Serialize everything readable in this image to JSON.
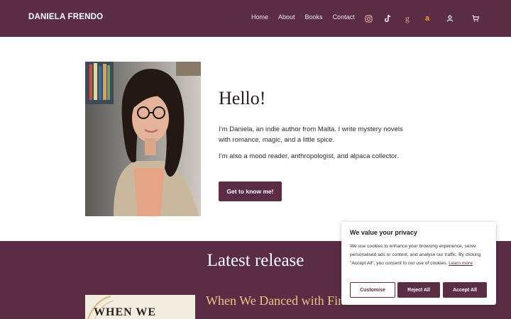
{
  "header": {
    "brand": "DANIELA FRENDO",
    "nav": [
      "Home",
      "About",
      "Books",
      "Contact"
    ],
    "icons": [
      "instagram-icon",
      "tiktok-icon",
      "goodreads-icon",
      "amazon-icon",
      "user-icon",
      "cart-icon"
    ],
    "goodreads_glyph": "g",
    "amazon_glyph": "a"
  },
  "hero": {
    "heading": "Hello!",
    "paragraph1": "I’m Daniela, an indie author from Malta. I write mystery novels with romance, magic, and a little spice.",
    "paragraph2": "I’m also a mood reader, anthropologist, and alpaca collector.",
    "cta_label": "Get to know me!"
  },
  "release": {
    "section_title": "Latest release",
    "book_title": "When We Danced with Fire",
    "cover_text": "WHEN WE"
  },
  "cookie": {
    "title": "We value your privacy",
    "text": "We use cookies to enhance your browsing experience, serve personalised ads or content, and analyse our traffic. By clicking \"Accept All\", you consent to our use of cookies.",
    "learn_more": "Learn more",
    "customise": "Customise",
    "reject": "Reject All",
    "accept": "Accept All"
  },
  "colors": {
    "brand_plum": "#5a2d45",
    "gold": "#e8c48a",
    "amazon": "#f0a030",
    "goodreads": "#d8b28a"
  }
}
